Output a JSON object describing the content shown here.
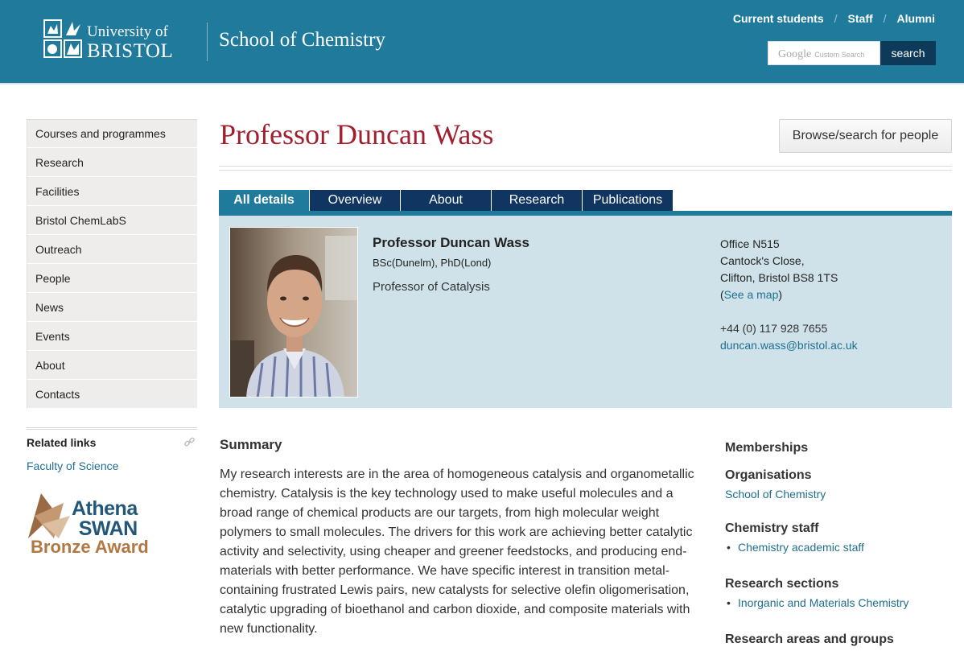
{
  "header": {
    "logo_line1": "University of",
    "logo_line2": "BRISTOL",
    "school_title": "School of Chemistry",
    "top_links": [
      "Current students",
      "Staff",
      "Alumni"
    ],
    "search_brand": "Google",
    "search_hint": "Custom Search",
    "search_button": "search",
    "colors": {
      "banner": "#1f7a9c",
      "search_button": "#0d3a59"
    }
  },
  "leftnav": {
    "items": [
      "Courses and programmes",
      "Research",
      "Facilities",
      "Bristol ChemLabS",
      "Outreach",
      "People",
      "News",
      "Events",
      "About",
      "Contacts"
    ]
  },
  "related": {
    "title": "Related links",
    "link": "Faculty of Science",
    "icon": "link-icon"
  },
  "award": {
    "line1": "Athena",
    "line2": "SWAN",
    "line3": "Bronze Award"
  },
  "page": {
    "title": "Professor Duncan Wass",
    "browse_button": "Browse/search for people",
    "title_color": "#a0202f"
  },
  "tabs": {
    "items": [
      "All details",
      "Overview",
      "About",
      "Research",
      "Publications"
    ],
    "active": "All details"
  },
  "profile": {
    "name": "Professor Duncan Wass",
    "qualifications": "BSc(Dunelm), PhD(Lond)",
    "role": "Professor of Catalysis",
    "address_lines": [
      "Office N515",
      "Cantock's Close,",
      "Clifton, Bristol BS8 1TS"
    ],
    "map_open": "(",
    "map_link": "See a map",
    "map_close": ")",
    "phone": "+44 (0) 117 928 7655",
    "email": "duncan.wass@bristol.ac.uk",
    "panel_color": "#cfe2ea"
  },
  "summary": {
    "heading": "Summary",
    "text": "My research interests are in the area of homogeneous catalysis and organometallic chemistry. Catalysis is the key technology used to make useful molecules and a broad range of chemical products are our targets, from high molecular weight polymers to small molecules. The drivers for this work are achieving better catalytic activity and selectivity, using cheaper and greener feedstocks, and producing end-materials with better performance. We have specific interest in transition metal-containing frustrated Lewis pairs, new catalysts for selective olefin oligomerisation, catalytic upgrading of bioethanol and carbon dioxide, and composite materials with new functionality."
  },
  "memberships": {
    "heading": "Memberships",
    "organisations": {
      "heading": "Organisations",
      "link": "School of Chemistry"
    },
    "chemistry_staff": {
      "heading": "Chemistry staff",
      "items": [
        "Chemistry academic staff"
      ]
    },
    "research_sections": {
      "heading": "Research sections",
      "items": [
        "Inorganic and Materials Chemistry"
      ]
    },
    "research_areas": {
      "heading": "Research areas and groups"
    }
  }
}
